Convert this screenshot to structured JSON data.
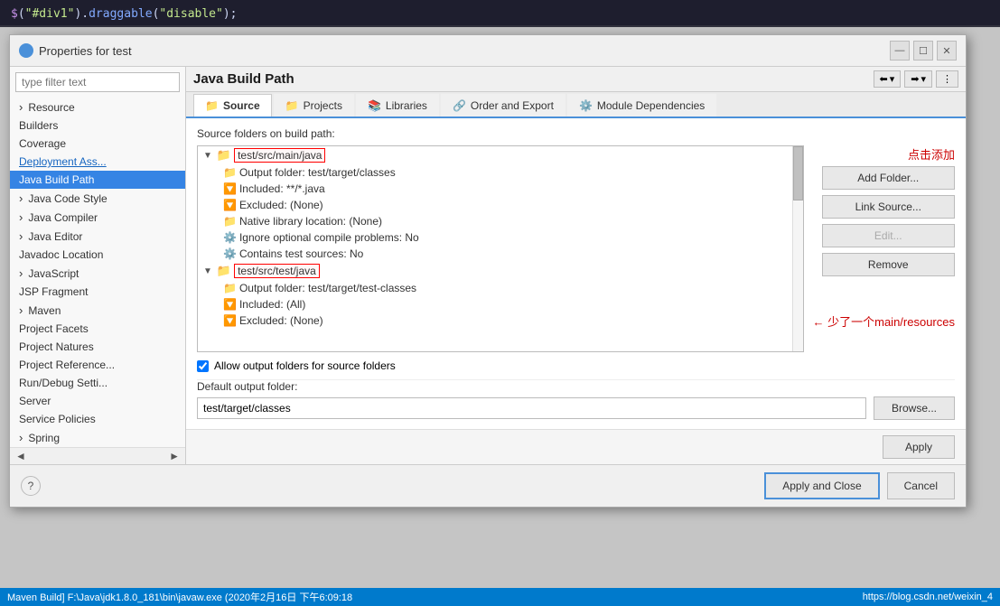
{
  "window": {
    "title": "Properties for test",
    "icon": "eclipse-icon"
  },
  "background_code": {
    "line": "$(\"#div1\").draggable(\"disable\");"
  },
  "filter": {
    "placeholder": "type filter text"
  },
  "sidebar": {
    "items": [
      {
        "id": "resource",
        "label": "Resource",
        "hasArrow": true,
        "expanded": false,
        "selected": false,
        "indent": 0
      },
      {
        "id": "builders",
        "label": "Builders",
        "hasArrow": false,
        "expanded": false,
        "selected": false,
        "indent": 0
      },
      {
        "id": "coverage",
        "label": "Coverage",
        "hasArrow": false,
        "expanded": false,
        "selected": false,
        "indent": 0
      },
      {
        "id": "deployment-ass",
        "label": "Deployment Ass...",
        "hasArrow": false,
        "expanded": false,
        "selected": false,
        "indent": 0
      },
      {
        "id": "java-build-path",
        "label": "Java Build Path",
        "hasArrow": false,
        "expanded": false,
        "selected": true,
        "indent": 0
      },
      {
        "id": "java-code-style",
        "label": "Java Code Style",
        "hasArrow": true,
        "expanded": false,
        "selected": false,
        "indent": 0
      },
      {
        "id": "java-compiler",
        "label": "Java Compiler",
        "hasArrow": true,
        "expanded": false,
        "selected": false,
        "indent": 0
      },
      {
        "id": "java-editor",
        "label": "Java Editor",
        "hasArrow": true,
        "expanded": false,
        "selected": false,
        "indent": 0
      },
      {
        "id": "javadoc-location",
        "label": "Javadoc Location",
        "hasArrow": false,
        "expanded": false,
        "selected": false,
        "indent": 0
      },
      {
        "id": "javascript",
        "label": "JavaScript",
        "hasArrow": true,
        "expanded": false,
        "selected": false,
        "indent": 0
      },
      {
        "id": "jsp-fragment",
        "label": "JSP Fragment",
        "hasArrow": false,
        "expanded": false,
        "selected": false,
        "indent": 0
      },
      {
        "id": "maven",
        "label": "Maven",
        "hasArrow": true,
        "expanded": false,
        "selected": false,
        "indent": 0
      },
      {
        "id": "project-facets",
        "label": "Project Facets",
        "hasArrow": false,
        "expanded": false,
        "selected": false,
        "indent": 0
      },
      {
        "id": "project-natures",
        "label": "Project Natures",
        "hasArrow": false,
        "expanded": false,
        "selected": false,
        "indent": 0
      },
      {
        "id": "project-references",
        "label": "Project Reference...",
        "hasArrow": false,
        "expanded": false,
        "selected": false,
        "indent": 0
      },
      {
        "id": "run-debug-settings",
        "label": "Run/Debug Setti...",
        "hasArrow": false,
        "expanded": false,
        "selected": false,
        "indent": 0
      },
      {
        "id": "server",
        "label": "Server",
        "hasArrow": false,
        "expanded": false,
        "selected": false,
        "indent": 0
      },
      {
        "id": "service-policies",
        "label": "Service Policies",
        "hasArrow": false,
        "expanded": false,
        "selected": false,
        "indent": 0
      },
      {
        "id": "spring",
        "label": "Spring",
        "hasArrow": true,
        "expanded": false,
        "selected": false,
        "indent": 0
      }
    ]
  },
  "content": {
    "title": "Java Build Path",
    "tabs": [
      {
        "id": "source",
        "label": "Source",
        "icon": "📁",
        "active": true
      },
      {
        "id": "projects",
        "label": "Projects",
        "icon": "📁",
        "active": false
      },
      {
        "id": "libraries",
        "label": "Libraries",
        "icon": "📚",
        "active": false
      },
      {
        "id": "order-export",
        "label": "Order and Export",
        "icon": "🔗",
        "active": false
      },
      {
        "id": "module-dependencies",
        "label": "Module Dependencies",
        "icon": "⚙️",
        "active": false
      }
    ],
    "section_title": "Source folders on build path:",
    "tree": {
      "nodes": [
        {
          "id": "main-java",
          "label": "test/src/main/java",
          "level": 1,
          "expanded": true,
          "isFolder": true,
          "highlighted": true
        },
        {
          "id": "main-java-output",
          "label": "Output folder: test/target/classes",
          "level": 2,
          "expanded": false,
          "isFolder": false,
          "highlighted": false
        },
        {
          "id": "main-java-included",
          "label": "Included: **/*.java",
          "level": 2,
          "expanded": false,
          "isFolder": false,
          "highlighted": false
        },
        {
          "id": "main-java-excluded",
          "label": "Excluded: (None)",
          "level": 2,
          "expanded": false,
          "isFolder": false,
          "highlighted": false
        },
        {
          "id": "main-java-native",
          "label": "Native library location: (None)",
          "level": 2,
          "expanded": false,
          "isFolder": false,
          "highlighted": false
        },
        {
          "id": "main-java-ignore",
          "label": "Ignore optional compile problems: No",
          "level": 2,
          "expanded": false,
          "isFolder": false,
          "highlighted": false
        },
        {
          "id": "main-java-test-sources",
          "label": "Contains test sources: No",
          "level": 2,
          "expanded": false,
          "isFolder": false,
          "highlighted": false
        },
        {
          "id": "test-java",
          "label": "test/src/test/java",
          "level": 1,
          "expanded": true,
          "isFolder": true,
          "highlighted": true
        },
        {
          "id": "test-java-output",
          "label": "Output folder: test/target/test-classes",
          "level": 2,
          "expanded": false,
          "isFolder": false,
          "highlighted": false
        },
        {
          "id": "test-java-included",
          "label": "Included: (All)",
          "level": 2,
          "expanded": false,
          "isFolder": false,
          "highlighted": false
        },
        {
          "id": "test-java-excluded",
          "label": "Excluded: (None)",
          "level": 2,
          "expanded": false,
          "isFolder": false,
          "highlighted": false
        }
      ]
    },
    "buttons": {
      "add_folder": "Add Folder...",
      "link_source": "Link Source...",
      "edit": "Edit...",
      "remove": "Remove"
    },
    "annotations": {
      "click_to_add": "点击添加",
      "missing_resources": "少了一个main/resources"
    },
    "allow_output_folders": {
      "checked": true,
      "label": "Allow output folders for source folders"
    },
    "default_output_folder": {
      "label": "Default output folder:",
      "value": "test/target/classes",
      "browse_label": "Browse..."
    },
    "apply_label": "Apply"
  },
  "footer": {
    "apply_close_label": "Apply and Close",
    "cancel_label": "Cancel",
    "help_icon": "?"
  },
  "status_bar": {
    "left": "Maven Build] F:\\Java\\jdk1.8.0_181\\bin\\javaw.exe (2020年2月16日 下午6:09:18",
    "right": "https://blog.csdn.net/weixin_4"
  }
}
